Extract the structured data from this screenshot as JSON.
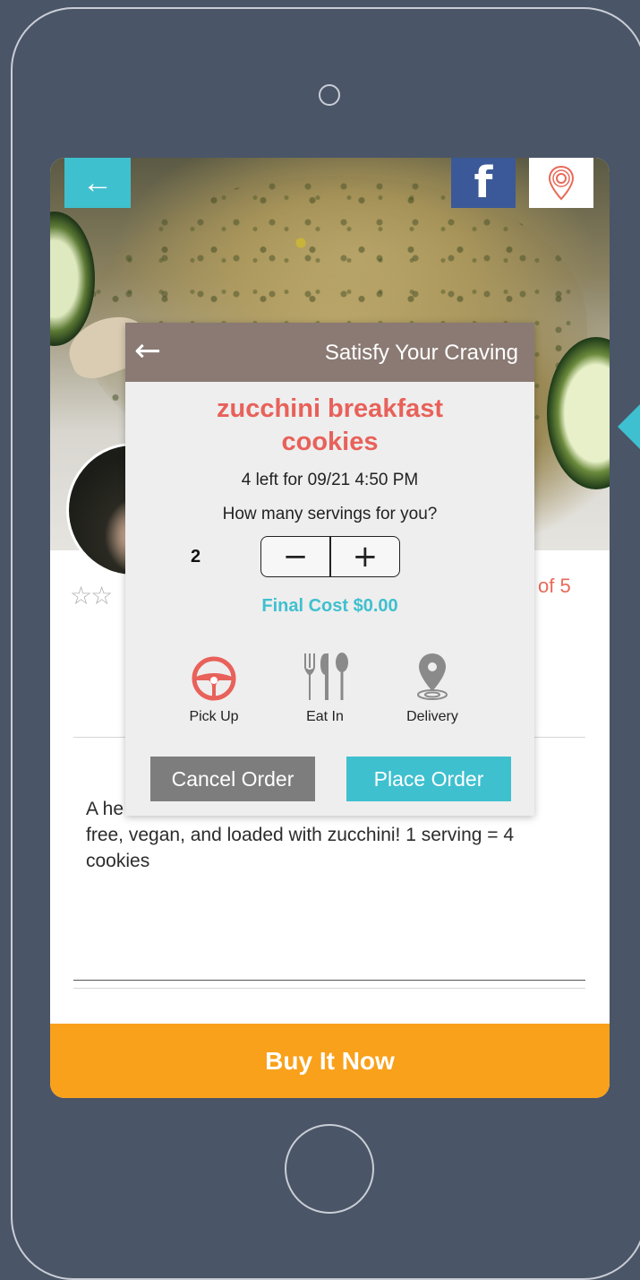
{
  "detail": {
    "back_icon": "arrow-left-icon",
    "facebook_icon": "facebook-icon",
    "location_icon": "location-pin-icon",
    "rating_stars": "☆☆",
    "rating_suffix": "of 5",
    "description_visible": "A he                                                        n",
    "description_line2": "free, vegan, and loaded with zucchini! 1 serving = 4",
    "description_line3": "cookies",
    "buy_label": "Buy It Now"
  },
  "modal": {
    "title": "Satisfy Your Craving",
    "back_glyph": "←",
    "product_name_line1": "zucchini breakfast",
    "product_name_line2": "cookies",
    "availability": "4 left for 09/21 4:50 PM",
    "question": "How many servings for you?",
    "quantity": "2",
    "minus_label": "−",
    "plus_label": "+",
    "final_cost": "Final Cost $0.00",
    "options": [
      {
        "label": "Pick Up",
        "icon": "steering-wheel-icon",
        "color": "#e8615a"
      },
      {
        "label": "Eat In",
        "icon": "fork-spoon-icon",
        "color": "#8a8a8a"
      },
      {
        "label": "Delivery",
        "icon": "map-pin-icon",
        "color": "#8a8a8a"
      }
    ],
    "cancel_label": "Cancel Order",
    "place_label": "Place Order"
  },
  "colors": {
    "accent_teal": "#3fc0cf",
    "accent_orange": "#f9a11b",
    "product_red": "#e8615a",
    "header_brown": "#8a7a73",
    "facebook_blue": "#3b5998"
  }
}
